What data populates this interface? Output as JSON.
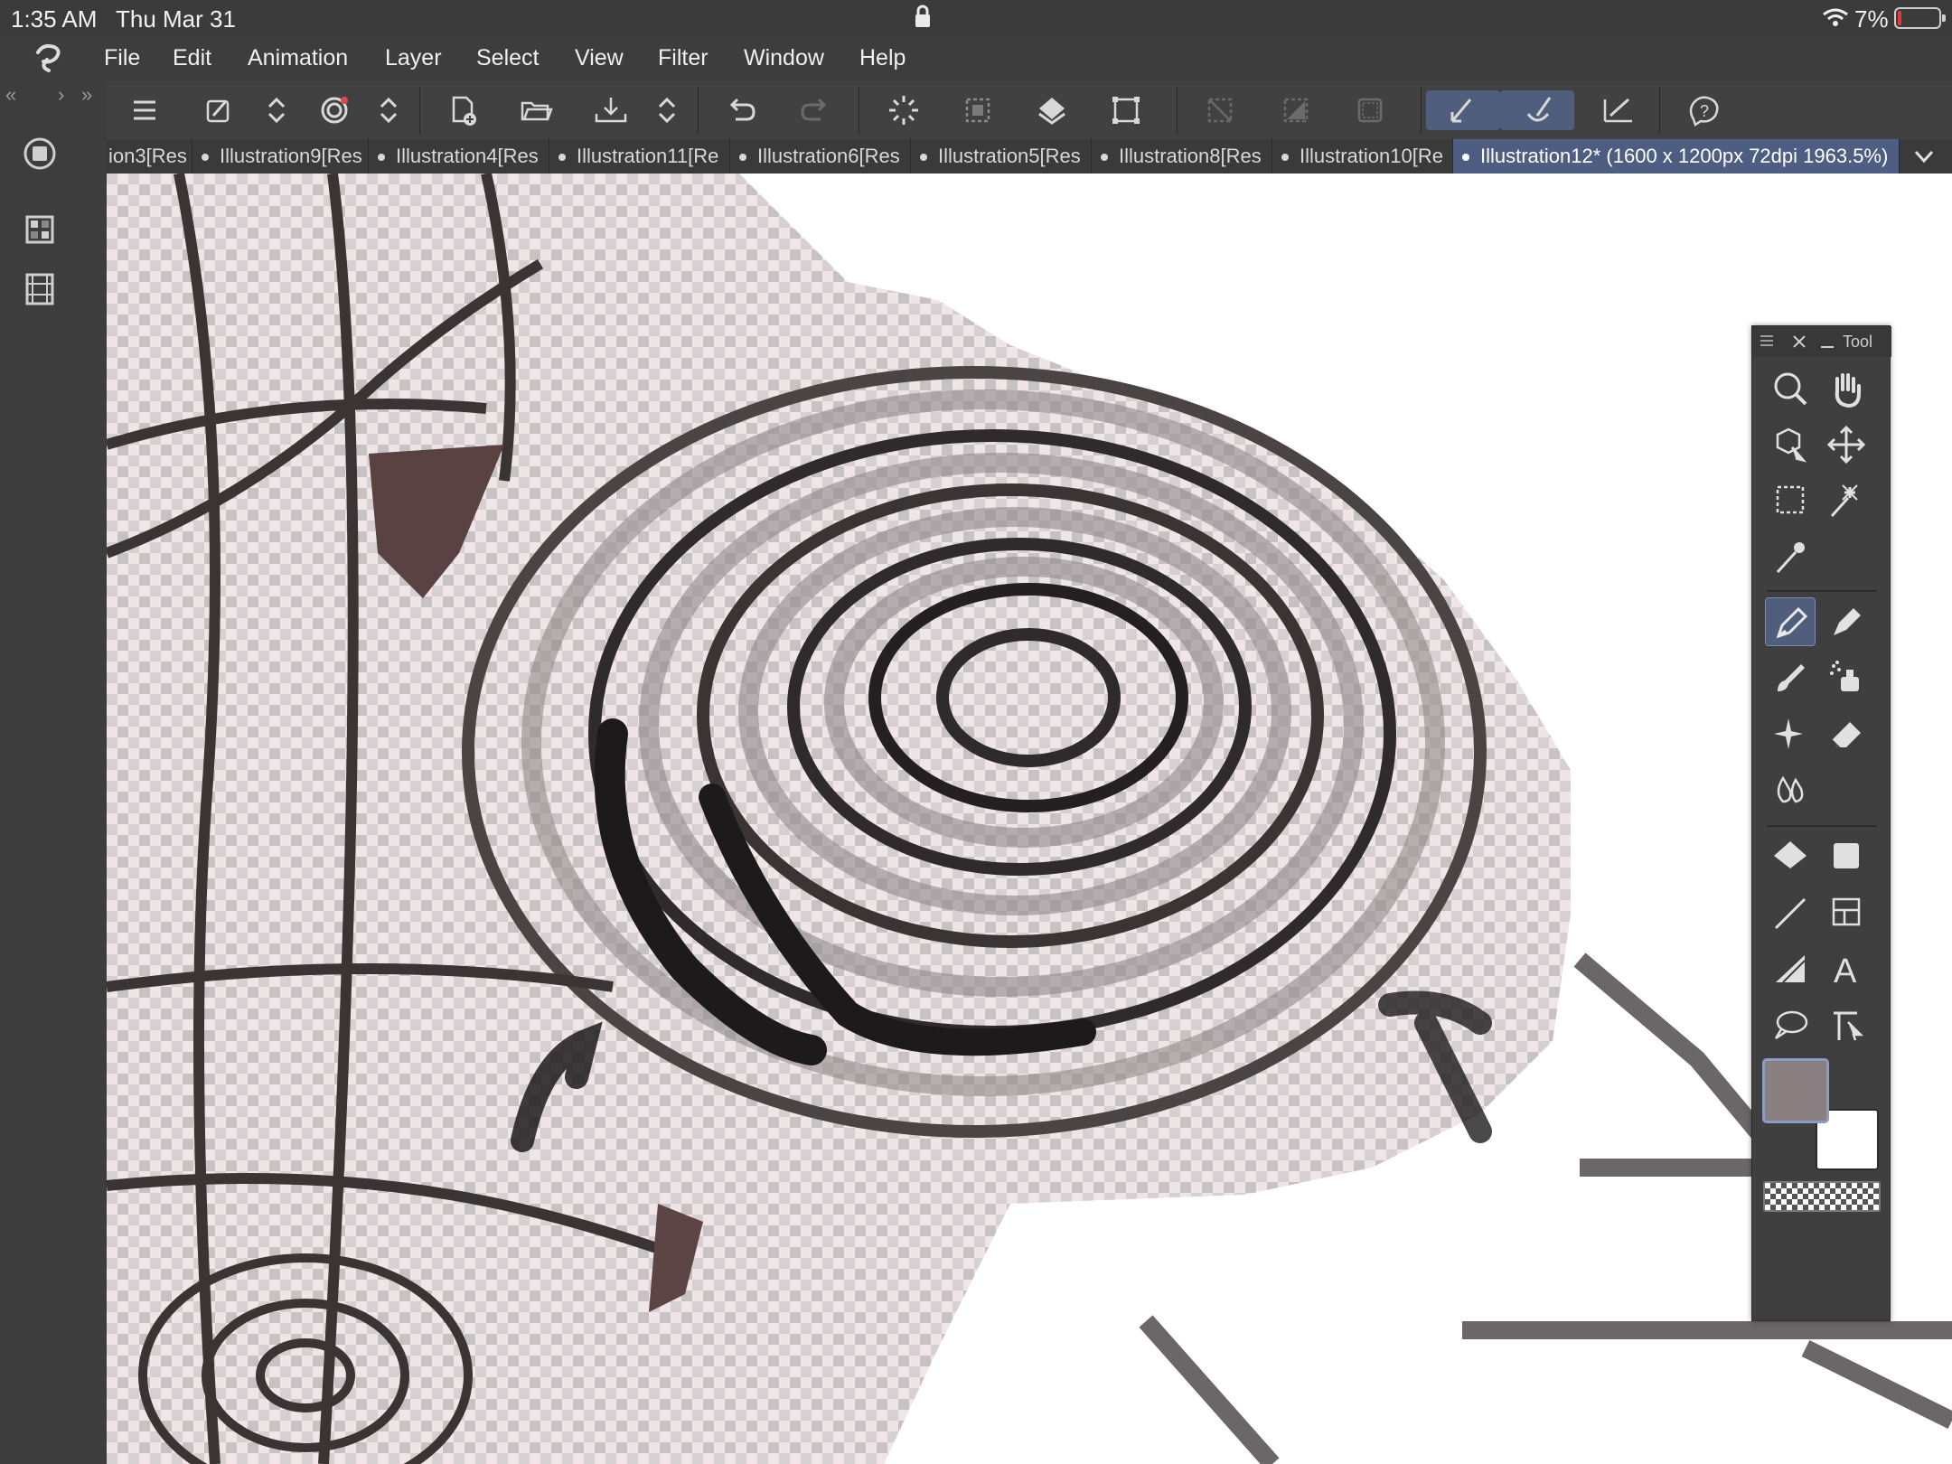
{
  "status_bar": {
    "time": "1:35 AM",
    "date": "Thu Mar 31",
    "battery_percent": "7%"
  },
  "menu": {
    "items": [
      "File",
      "Edit",
      "Animation",
      "Layer",
      "Select",
      "View",
      "Filter",
      "Window",
      "Help"
    ]
  },
  "left_strip": {
    "collapse_label": "«",
    "next_label": "›",
    "expand_label": "»"
  },
  "toolbar": {
    "icons": [
      "menu-icon",
      "brush-settings-icon",
      "updown-icon",
      "spiral-icon",
      "updown-icon",
      "new-canvas-icon",
      "open-folder-icon",
      "save-icon",
      "updown-icon",
      "undo-icon",
      "redo-icon",
      "loading-icon",
      "clear-selection-icon",
      "fill-icon",
      "transform-icon",
      "deselect-icon",
      "invert-selection-icon",
      "selection-border-icon",
      "pen-active-icon",
      "brush-active-icon",
      "ruler-icon",
      "help-icon"
    ]
  },
  "tabs": [
    {
      "label": "ion3[Res",
      "active": false,
      "dot": false
    },
    {
      "label": "Illustration9[Res",
      "active": false,
      "dot": true
    },
    {
      "label": "Illustration4[Res",
      "active": false,
      "dot": true
    },
    {
      "label": "Illustration11[Re",
      "active": false,
      "dot": true
    },
    {
      "label": "Illustration6[Res",
      "active": false,
      "dot": true
    },
    {
      "label": "Illustration5[Res",
      "active": false,
      "dot": true
    },
    {
      "label": "Illustration8[Res",
      "active": false,
      "dot": true
    },
    {
      "label": "Illustration10[Re",
      "active": false,
      "dot": true
    },
    {
      "label": "Illustration12* (1600 x 1200px 72dpi 1963.5%)",
      "active": true,
      "dot": true
    }
  ],
  "tool_panel": {
    "title": "Tool",
    "main_color": "#8a7f80",
    "sub_color": "#ffffff",
    "tools": [
      "zoom-icon",
      "hand-icon",
      "object-icon",
      "move-icon",
      "marquee-icon",
      "auto-select-icon",
      "eyedropper-icon",
      "pen-icon",
      "pencil-icon",
      "brush-icon",
      "airbrush-icon",
      "decoration-icon",
      "eraser-icon",
      "blend-icon",
      "fill-icon",
      "gradient-icon",
      "figure-icon",
      "frame-icon",
      "ruler-icon",
      "text-icon",
      "balloon-icon",
      "correct-line-icon"
    ]
  },
  "colors": {
    "accent": "#4f5e7c",
    "panel": "#3d3d3d",
    "canvas_bg": "#ffffff"
  }
}
